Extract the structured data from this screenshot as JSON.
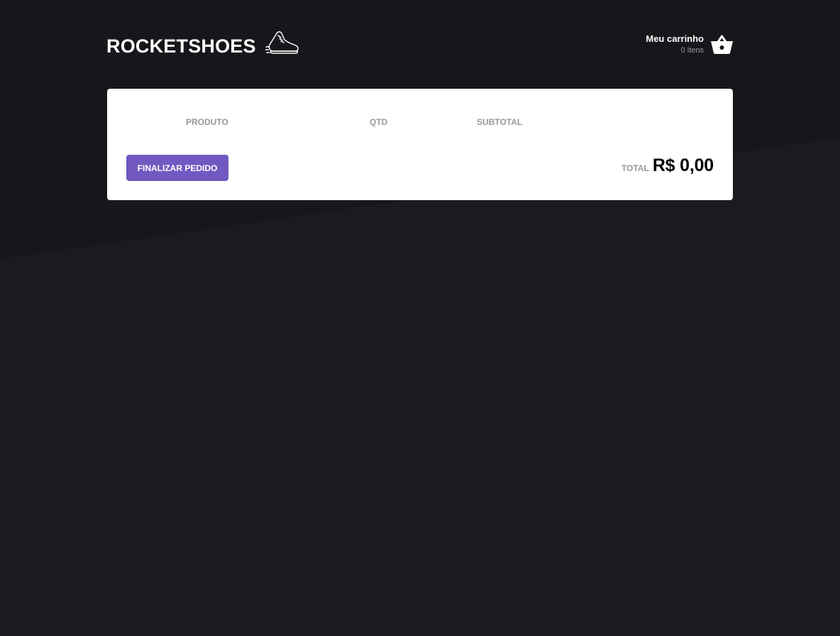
{
  "header": {
    "brand": "ROCKETSHOES",
    "cart": {
      "title": "Meu carrinho",
      "count": "0 itens"
    }
  },
  "icons": {
    "logo": "running-shoe-icon",
    "cart": "shopping-basket-icon"
  },
  "table": {
    "headers": [
      "PRODUTO",
      "QTD",
      "SUBTOTAL"
    ],
    "rows": []
  },
  "footer": {
    "button_label": "FINALIZAR PEDIDO",
    "total_label": "TOTAL",
    "total_value": "R$ 0,00"
  },
  "colors": {
    "background": "#1a1b20",
    "background_top": "#17171b",
    "panel": "#ffffff",
    "accent": "#7159c1",
    "muted_text": "#999999"
  }
}
